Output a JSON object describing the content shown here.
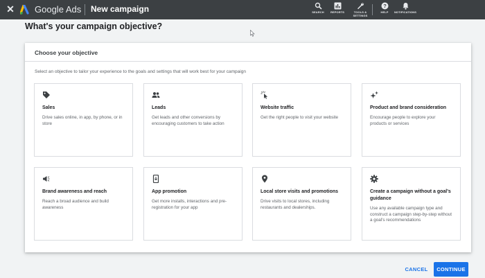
{
  "topbar": {
    "brand": "Google Ads",
    "page_name": "New campaign",
    "items": [
      {
        "label": "SEARCH",
        "icon": "search-icon"
      },
      {
        "label": "REPORTS",
        "icon": "reports-icon"
      },
      {
        "label_line1": "TOOLS &",
        "label_line2": "SETTINGS",
        "icon": "wrench-icon"
      },
      {
        "label": "HELP",
        "icon": "help-icon"
      },
      {
        "label": "NOTIFICATIONS",
        "icon": "bell-icon"
      }
    ]
  },
  "heading": "What's your campaign objective?",
  "card": {
    "title": "Choose your objective",
    "subtitle": "Select an objective to tailor your experience to the goals and settings that will work best for your campaign"
  },
  "objectives": [
    {
      "icon": "tag-icon",
      "title": "Sales",
      "description": "Drive sales online, in app, by phone, or in store"
    },
    {
      "icon": "people-icon",
      "title": "Leads",
      "description": "Get leads and other conversions by encouraging customers to take action"
    },
    {
      "icon": "click-icon",
      "title": "Website traffic",
      "description": "Get the right people to visit your website"
    },
    {
      "icon": "sparkle-icon",
      "title": "Product and brand consideration",
      "description": "Encourage people to explore your products or services"
    },
    {
      "icon": "megaphone-icon",
      "title": "Brand awareness and reach",
      "description": "Reach a broad audience and build awareness"
    },
    {
      "icon": "phone-icon",
      "title": "App promotion",
      "description": "Get more installs, interactions and pre-registration for your app"
    },
    {
      "icon": "pin-icon",
      "title": "Local store visits and promotions",
      "description": "Drive visits to local stores, including restaurants and dealerships."
    },
    {
      "icon": "gear-icon",
      "title": "Create a campaign without a goal's guidance",
      "description": "Use any available campaign type and construct a campaign step-by-step without a goal's recommendations"
    }
  ],
  "actions": {
    "cancel": "CANCEL",
    "continue": "CONTINUE"
  },
  "colors": {
    "topbar": "#3c4043",
    "accent": "#1a73e8",
    "background": "#f1f3f4"
  }
}
